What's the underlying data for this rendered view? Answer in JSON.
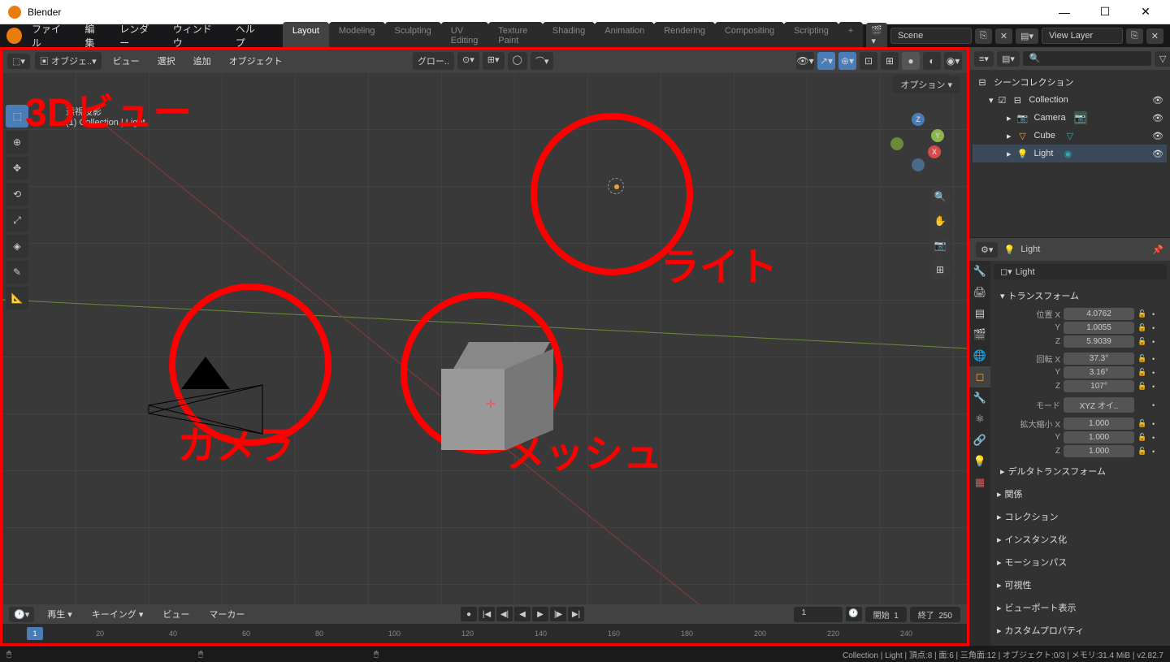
{
  "titlebar": {
    "title": "Blender"
  },
  "menu": {
    "file": "ファイル",
    "edit": "編集",
    "render": "レンダー",
    "window": "ウィンドウ",
    "help": "ヘルプ"
  },
  "workspaces": [
    "Layout",
    "Modeling",
    "Sculpting",
    "UV Editing",
    "Texture Paint",
    "Shading",
    "Animation",
    "Rendering",
    "Compositing",
    "Scripting"
  ],
  "scene": {
    "name": "Scene",
    "layer": "View Layer"
  },
  "viewport": {
    "header": {
      "view": "ビュー",
      "select": "選択",
      "add": "追加",
      "object": "オブジェクト",
      "mode_dd": "グロー..",
      "options": "オプション"
    },
    "info": {
      "proj": "透視投影",
      "collection": "(1) Collection | Light"
    },
    "annotations": {
      "view3d": "3Dビュー",
      "light": "ライト",
      "camera": "カメラ",
      "mesh": "メッシュ"
    }
  },
  "timeline": {
    "menu": {
      "playback": "再生",
      "keying": "キーイング",
      "view": "ビュー",
      "marker": "マーカー"
    },
    "current": "1",
    "start_label": "開始",
    "start": "1",
    "end_label": "終了",
    "end": "250",
    "ticks": [
      "20",
      "40",
      "60",
      "80",
      "100",
      "120",
      "140",
      "160",
      "180",
      "200",
      "220",
      "240"
    ]
  },
  "outliner": {
    "scene_collection": "シーンコレクション",
    "collection": "Collection",
    "items": [
      {
        "name": "Camera",
        "icon": "📷"
      },
      {
        "name": "Cube",
        "icon": "▽"
      },
      {
        "name": "Light",
        "icon": "💡"
      }
    ]
  },
  "properties": {
    "header": "Light",
    "name": "Light",
    "transform": "トランスフォーム",
    "loc_label": "位置",
    "rot_label": "回転",
    "scale_label": "拡大縮小",
    "mode_label": "モード",
    "mode_val": "XYZ オイ..",
    "loc": {
      "x": "4.0762",
      "y": "1.0055",
      "z": "5.9039"
    },
    "rot": {
      "x": "37.3°",
      "y": "3.16°",
      "z": "107°"
    },
    "scale": {
      "x": "1.000",
      "y": "1.000",
      "z": "1.000"
    },
    "sections": [
      "デルタトランスフォーム",
      "関係",
      "コレクション",
      "インスタンス化",
      "モーションパス",
      "可視性",
      "ビューポート表示",
      "カスタムプロパティ"
    ]
  },
  "statusbar": {
    "right": "Collection | Light | 頂点:8 | 面:6 | 三角面:12 | オブジェクト:0/3 | メモリ:31.4 MiB | v2.82.7"
  }
}
